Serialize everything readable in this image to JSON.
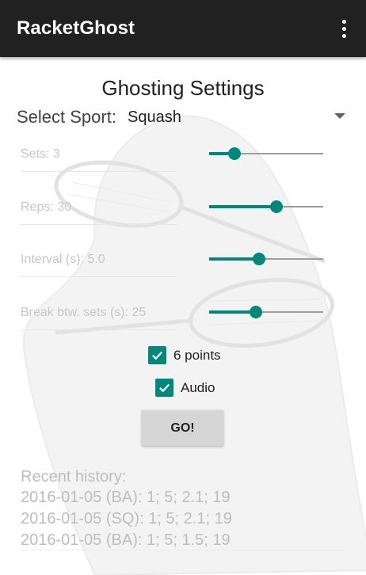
{
  "app": {
    "title": "RacketGhost",
    "overflow_icon": "more-vert-icon"
  },
  "page": {
    "heading": "Ghosting Settings"
  },
  "sport": {
    "label": "Select Sport:",
    "value": "Squash"
  },
  "settings": [
    {
      "label": "Sets: 3",
      "level": 0.22
    },
    {
      "label": "Reps: 30",
      "level": 0.59
    },
    {
      "label": "Interval (s): 5.0",
      "level": 0.44
    },
    {
      "label": "Break btw. sets (s): 25",
      "level": 0.41
    }
  ],
  "options": [
    {
      "label": "6 points",
      "checked": true
    },
    {
      "label": "Audio",
      "checked": true
    }
  ],
  "go_button": {
    "label": "GO!"
  },
  "history": {
    "title": "Recent history:",
    "entries": [
      "2016-01-05 (BA): 1; 5; 2.1; 19",
      "2016-01-05 (SQ): 1; 5; 2.1; 19",
      "2016-01-05 (BA): 1; 5; 1.5; 19"
    ]
  },
  "colors": {
    "accent": "#00897b",
    "appbar": "#212121",
    "button": "#d6d6d6"
  }
}
